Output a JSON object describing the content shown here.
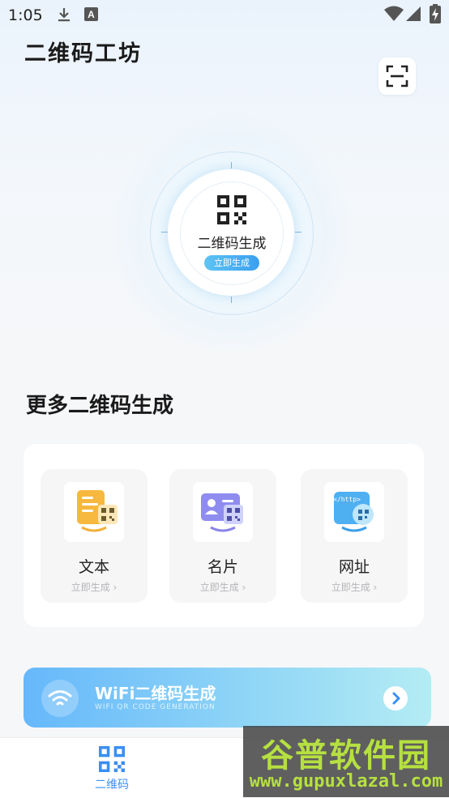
{
  "status_bar": {
    "time": "1:05",
    "icons": [
      "download-icon",
      "font-icon",
      "wifi-signal-icon",
      "cell-signal-icon",
      "battery-charging-icon"
    ]
  },
  "header": {
    "title": "二维码工坊",
    "scan_icon": "scan-icon"
  },
  "hero": {
    "label": "二维码生成",
    "badge": "立即生成",
    "icon": "qr-code-icon"
  },
  "more": {
    "title": "更多二维码生成",
    "items": [
      {
        "label": "文本",
        "sub": "立即生成 ›",
        "icon": "text-doc-icon"
      },
      {
        "label": "名片",
        "sub": "立即生成 ›",
        "icon": "business-card-icon"
      },
      {
        "label": "网址",
        "sub": "立即生成 ›",
        "icon": "url-browser-icon"
      }
    ]
  },
  "wifi": {
    "title": "WiFi二维码生成",
    "subtitle": "WIFI QR CODE GENERATION",
    "icon": "wifi-icon",
    "arrow_icon": "chevron-right-icon"
  },
  "tabbar": {
    "tabs": [
      {
        "label": "二维码",
        "icon": "qr-code-icon",
        "active": true
      }
    ]
  },
  "watermark": {
    "title": "谷普软件园",
    "url": "www.gupuxlazal.com"
  },
  "colors": {
    "accent": "#3a8ff2",
    "badge": "#3a9ff0",
    "wifi_banner_start": "#66b8fb",
    "wifi_banner_end": "#b4ecf4",
    "watermark_text": "#b6e040"
  }
}
